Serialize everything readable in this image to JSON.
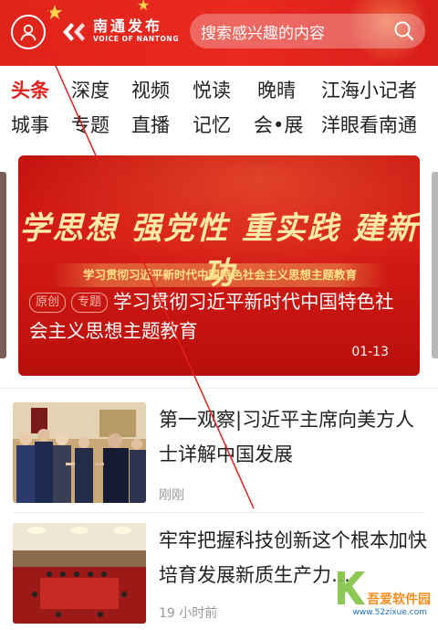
{
  "header": {
    "logo": {
      "name_cn": "南通发布",
      "name_en": "VOICE OF NANTONG"
    },
    "search": {
      "placeholder": "搜索感兴趣的内容"
    },
    "colors": {
      "brand_red": "#e3201b"
    }
  },
  "tabs": {
    "row1": [
      "头条",
      "深度",
      "视频",
      "悦读",
      "晚晴",
      "江海小记者"
    ],
    "row2": [
      "城事",
      "专题",
      "直播",
      "记忆",
      "会•展",
      "洋眼看南通"
    ],
    "active": "头条"
  },
  "banner": {
    "slogan": "学思想  强党性  重实践  建新功",
    "ribbon": "学习贯彻习近平新时代中国特色社会主义思想主题教育",
    "tags": [
      "原创",
      "专题"
    ],
    "title": "学习贯彻习近平新时代中国特色社会主义思想主题教育",
    "date": "01-13"
  },
  "news": [
    {
      "headline": "第一观察|习近平主席向美方人士详解中国发展",
      "time": "刚刚"
    },
    {
      "headline": "牢牢把握科技创新这个根本加快培育发展新质生产力…",
      "time": "19 小时前"
    }
  ],
  "watermark": {
    "brand": "吾爱软件园",
    "url": "www.52zixue.com"
  }
}
